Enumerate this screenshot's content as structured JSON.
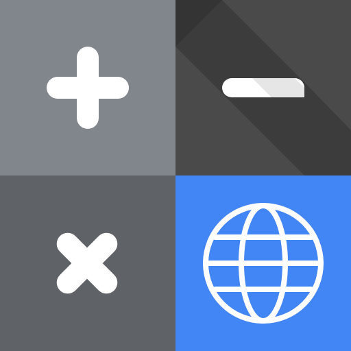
{
  "app_icon": {
    "tiles": [
      {
        "name": "plus-tile",
        "icon": "plus-icon",
        "background": "#80868B"
      },
      {
        "name": "minus-tile",
        "icon": "minus-icon",
        "background": "#4A4A4A",
        "shadow": "#3C3C3C"
      },
      {
        "name": "multiply-tile",
        "icon": "multiply-icon",
        "background": "#5F6368"
      },
      {
        "name": "globe-tile",
        "icon": "globe-icon",
        "background": "#4285F4"
      }
    ],
    "glyph_color": "#FFFFFF"
  }
}
